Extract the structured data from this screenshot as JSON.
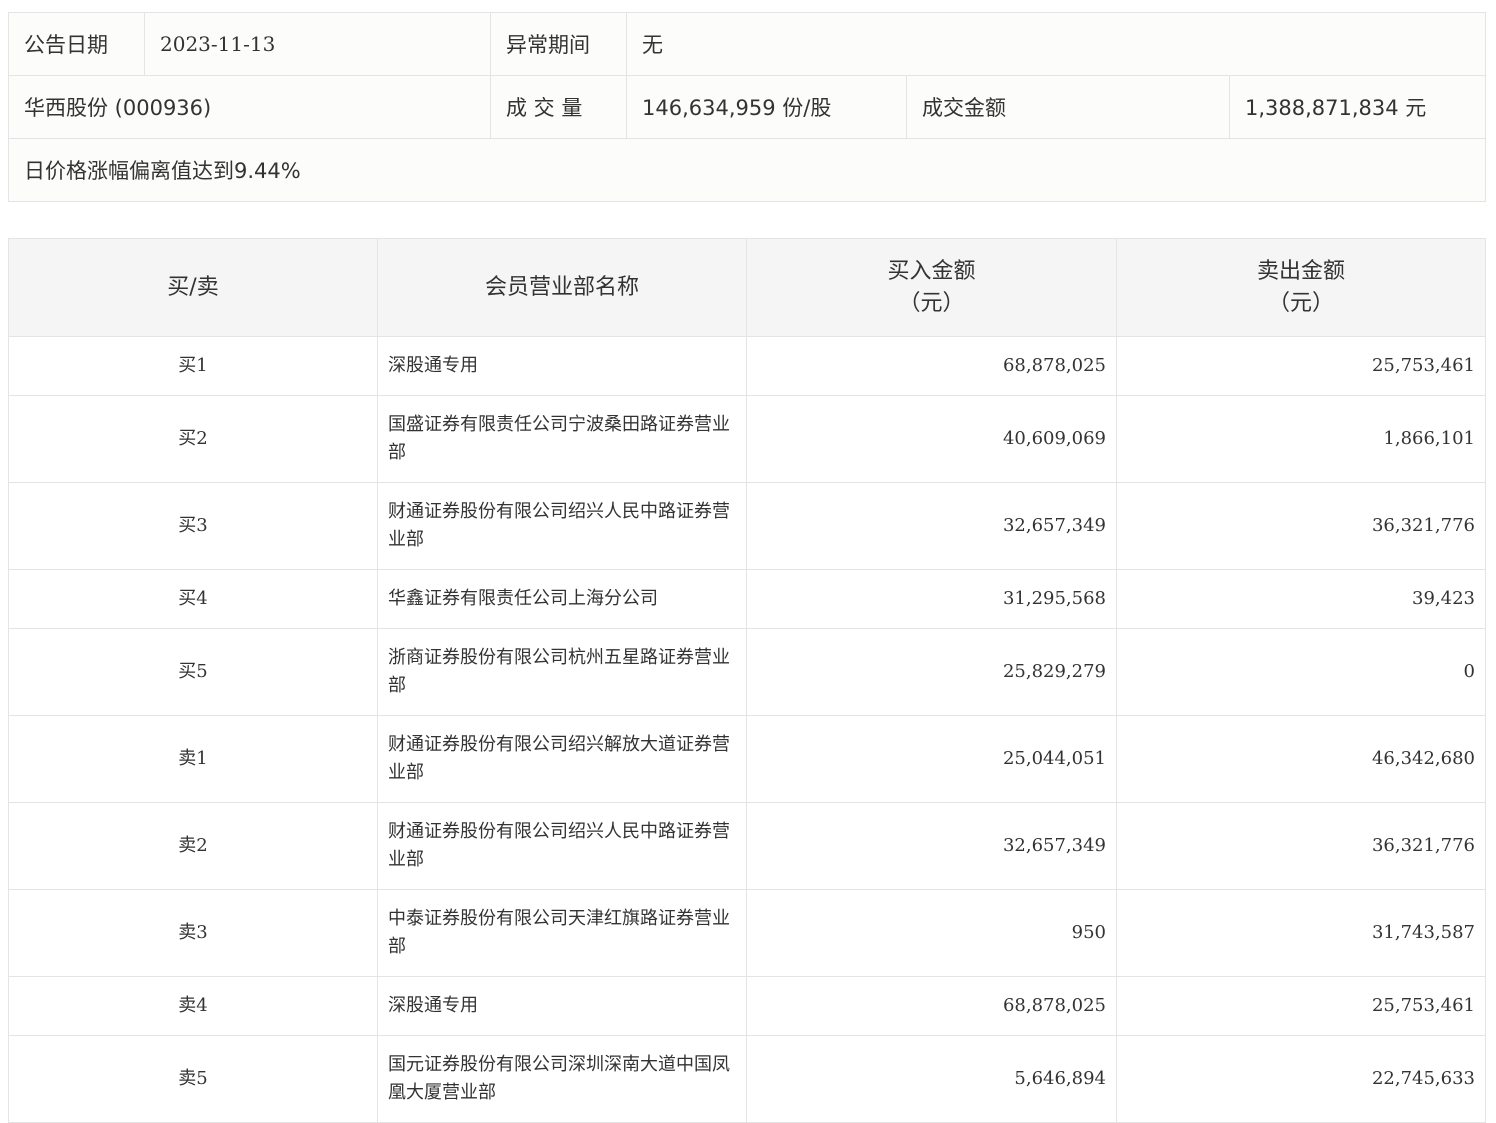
{
  "summary": {
    "date_label": "公告日期",
    "date_value": "2023-11-13",
    "period_label": "异常期间",
    "period_value": "无",
    "stock_name": "华西股份 (000936)",
    "volume_label": "成 交 量",
    "volume_value": "146,634,959 份/股",
    "amount_label": "成交金额",
    "amount_value": "1,388,871,834 元",
    "reason": "日价格涨幅偏离值达到9.44%"
  },
  "table": {
    "headers": {
      "side": "买/卖",
      "dept": "会员营业部名称",
      "buy_line1": "买入金额",
      "buy_line2": "（元）",
      "sell_line1": "卖出金额",
      "sell_line2": "（元）"
    },
    "rows": [
      {
        "side": "买1",
        "dept": "深股通专用",
        "buy": "68,878,025",
        "sell": "25,753,461"
      },
      {
        "side": "买2",
        "dept": "国盛证券有限责任公司宁波桑田路证券营业部",
        "buy": "40,609,069",
        "sell": "1,866,101"
      },
      {
        "side": "买3",
        "dept": "财通证券股份有限公司绍兴人民中路证券营业部",
        "buy": "32,657,349",
        "sell": "36,321,776"
      },
      {
        "side": "买4",
        "dept": "华鑫证券有限责任公司上海分公司",
        "buy": "31,295,568",
        "sell": "39,423"
      },
      {
        "side": "买5",
        "dept": "浙商证券股份有限公司杭州五星路证券营业部",
        "buy": "25,829,279",
        "sell": "0"
      },
      {
        "side": "卖1",
        "dept": "财通证券股份有限公司绍兴解放大道证券营业部",
        "buy": "25,044,051",
        "sell": "46,342,680"
      },
      {
        "side": "卖2",
        "dept": "财通证券股份有限公司绍兴人民中路证券营业部",
        "buy": "32,657,349",
        "sell": "36,321,776"
      },
      {
        "side": "卖3",
        "dept": "中泰证券股份有限公司天津红旗路证券营业部",
        "buy": "950",
        "sell": "31,743,587"
      },
      {
        "side": "卖4",
        "dept": "深股通专用",
        "buy": "68,878,025",
        "sell": "25,753,461"
      },
      {
        "side": "卖5",
        "dept": "国元证券股份有限公司深圳深南大道中国凤凰大厦营业部",
        "buy": "5,646,894",
        "sell": "22,745,633"
      }
    ]
  }
}
